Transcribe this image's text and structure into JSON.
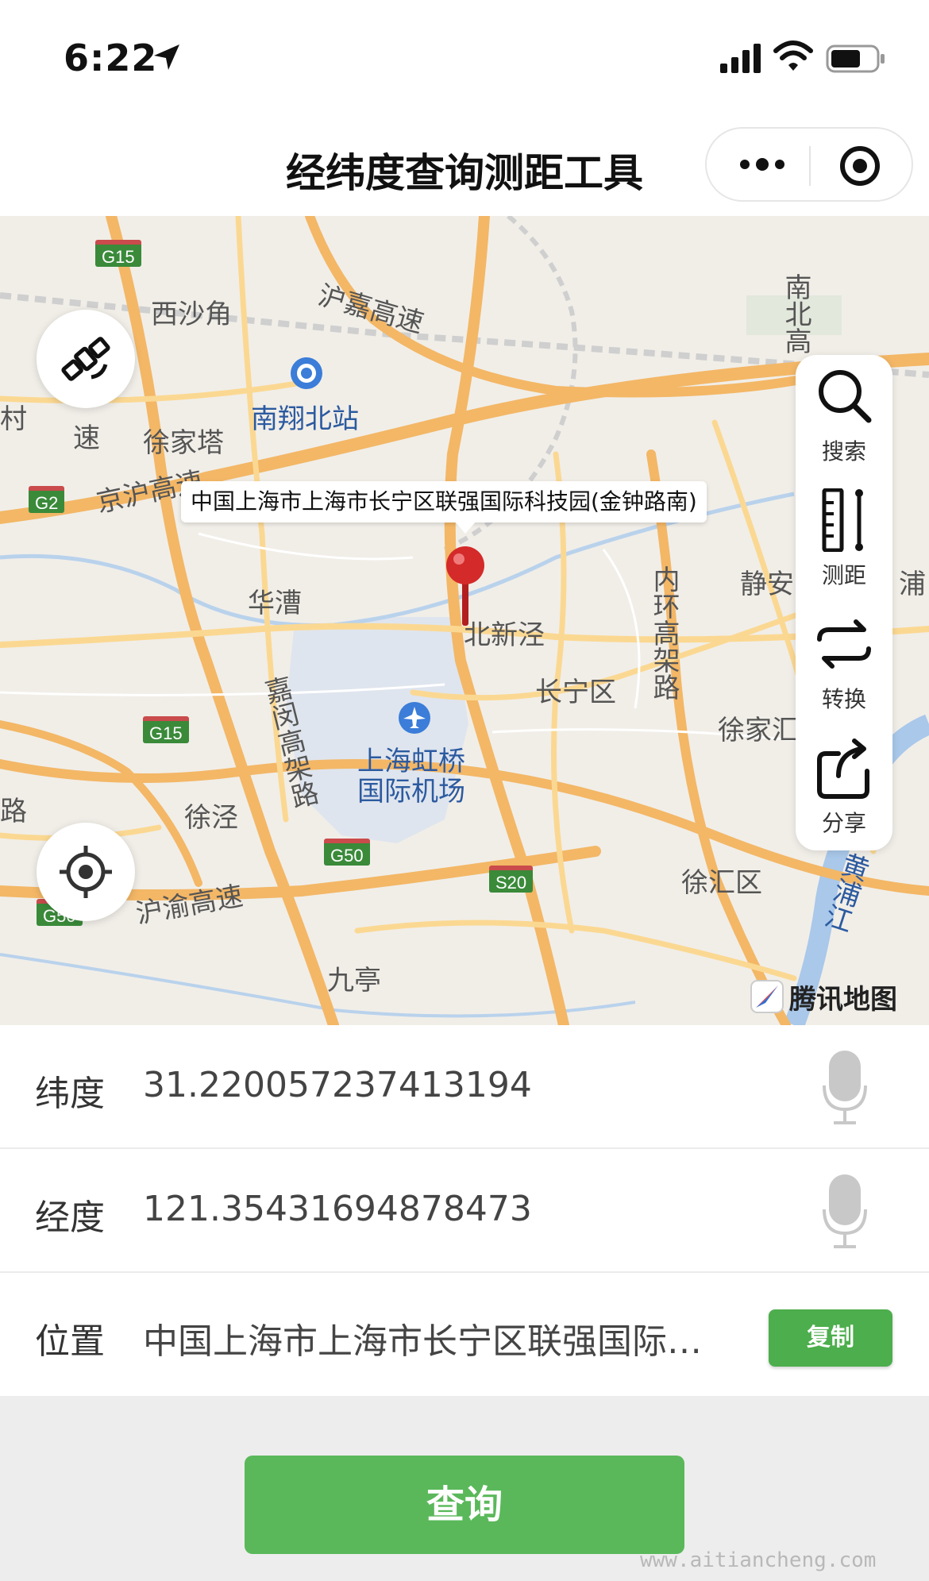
{
  "status_bar": {
    "time": "6:22"
  },
  "nav": {
    "title": "经纬度查询测距工具"
  },
  "map": {
    "callout": "中国上海市上海市长宁区联强国际科技园(金钟路南)",
    "labels": {
      "xishajiao": "西沙角",
      "hujia": "沪嘉高速",
      "nanxiang": "南翔北站",
      "xujiata": "徐家塔",
      "jinghu": "京沪高速",
      "huacao": "华漕",
      "beixinjing": "北新泾",
      "changning": "长宁区",
      "neihuan": "内环高架路",
      "jingan": "静安",
      "pu": "浦",
      "jiamin": "嘉闵高架路",
      "hongqiao": "上海虹桥国际机场",
      "xujiahui": "徐家汇",
      "xujing": "徐泾",
      "huyu": "沪渝高速",
      "xuhui": "徐汇区",
      "jiuting": "九亭",
      "huangpujiang": "黄浦江",
      "nanbei": "南北高",
      "cun": "村",
      "su": "速",
      "lu": "路"
    },
    "shields": [
      "G15",
      "G2",
      "G15",
      "G50",
      "S20",
      "G50"
    ],
    "tools": [
      {
        "label": "搜索",
        "icon": "search-icon"
      },
      {
        "label": "测距",
        "icon": "ruler-icon"
      },
      {
        "label": "转换",
        "icon": "swap-icon"
      },
      {
        "label": "分享",
        "icon": "share-icon"
      }
    ],
    "logo": "腾讯地图"
  },
  "form": {
    "lat_label": "纬度",
    "lat_value": "31.220057237413194",
    "lng_label": "经度",
    "lng_value": "121.35431694878473",
    "pos_label": "位置",
    "pos_value": "中国上海市上海市长宁区联强国际科技园(金钟路南)",
    "copy_label": "复制"
  },
  "query_label": "查询",
  "watermark": "www.aitiancheng.com",
  "colors": {
    "accent": "#5ab85a",
    "pin": "#d42a2a"
  }
}
